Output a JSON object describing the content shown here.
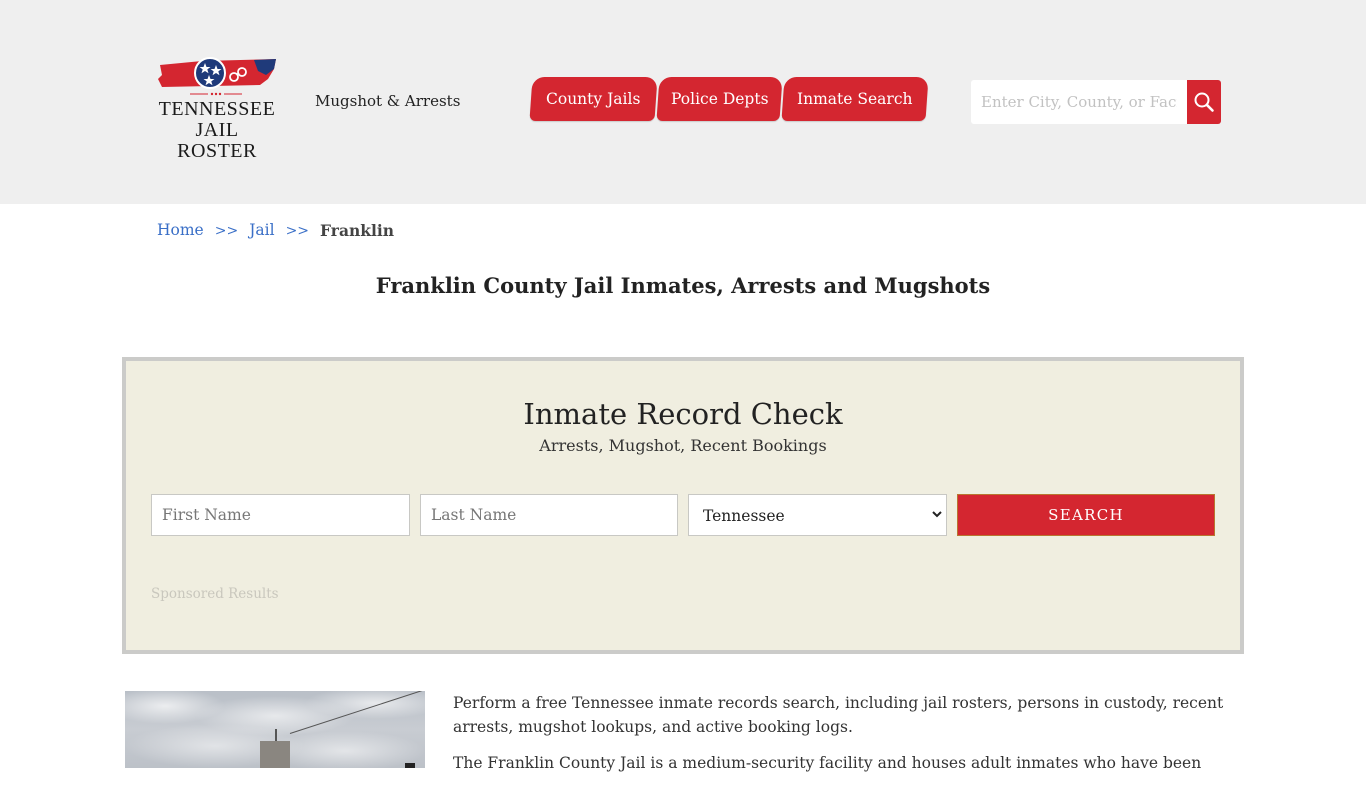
{
  "header": {
    "logo": {
      "line1": "TENNESSEE",
      "line2": "JAIL ROSTER",
      "colors": {
        "red": "#d42630",
        "blue": "#1f3a7a"
      }
    },
    "tagline": "Mugshot & Arrests",
    "nav": [
      {
        "label": "County Jails"
      },
      {
        "label": "Police Depts"
      },
      {
        "label": "Inmate Search"
      }
    ],
    "search": {
      "placeholder": "Enter City, County, or Facility",
      "value": "",
      "icon": "search-icon"
    }
  },
  "breadcrumb": {
    "items": [
      {
        "label": "Home"
      },
      {
        "label": "Jail"
      },
      {
        "label": "Franklin"
      }
    ],
    "separator": ">>"
  },
  "page_title": "Franklin County Jail Inmates, Arrests and Mugshots",
  "record_check": {
    "title": "Inmate Record Check",
    "subtitle": "Arrests, Mugshot, Recent Bookings",
    "first_name_placeholder": "First Name",
    "last_name_placeholder": "Last Name",
    "state_selected": "Tennessee",
    "search_label": "SEARCH",
    "sponsored_label": "Sponsored Results"
  },
  "content": {
    "paragraphs": [
      "Perform a free Tennessee inmate records search, including jail rosters, persons in custody, recent arrests, mugshot lookups, and active booking logs.",
      "The Franklin County Jail is a medium-security facility and houses adult inmates who have been"
    ]
  },
  "colors": {
    "accent": "#d42630",
    "header_bg": "#efefef",
    "panel_bg": "#f0eee0",
    "link": "#3a6fc7"
  }
}
